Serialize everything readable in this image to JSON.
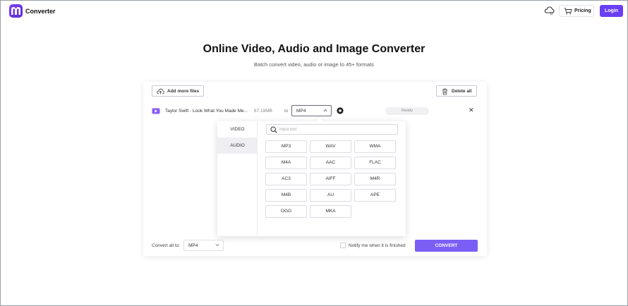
{
  "header": {
    "brand": "Converter",
    "pricing_label": "Pricing",
    "login_label": "Login"
  },
  "hero": {
    "title": "Online Video, Audio and Image Converter",
    "subtitle": "Batch convert video, audio or image to 45+ formats"
  },
  "toolbar": {
    "add_files_label": "Add more files",
    "delete_all_label": "Delete all"
  },
  "file": {
    "name": "Taylor Swift - Look What You Made Me...",
    "size": "67.19MB",
    "to_label": "to",
    "format": "MP4",
    "status": "Ready"
  },
  "dropdown": {
    "categories": [
      "VIDEO",
      "AUDIO"
    ],
    "active_category": "AUDIO",
    "search_placeholder": "Input text",
    "formats": [
      "MP3",
      "WAV",
      "WMA",
      "M4A",
      "AAC",
      "FLAC",
      "AC3",
      "AIFF",
      "M4R",
      "M4B",
      "AU",
      "APE",
      "OGG",
      "MKA"
    ]
  },
  "bottom": {
    "convert_all_label": "Convert all to:",
    "convert_all_value": "MP4",
    "notify_label": "Notify me when it is finished",
    "convert_label": "CONVERT"
  },
  "colors": {
    "accent": "#6a3ef5",
    "convert": "#7b5ff5"
  }
}
